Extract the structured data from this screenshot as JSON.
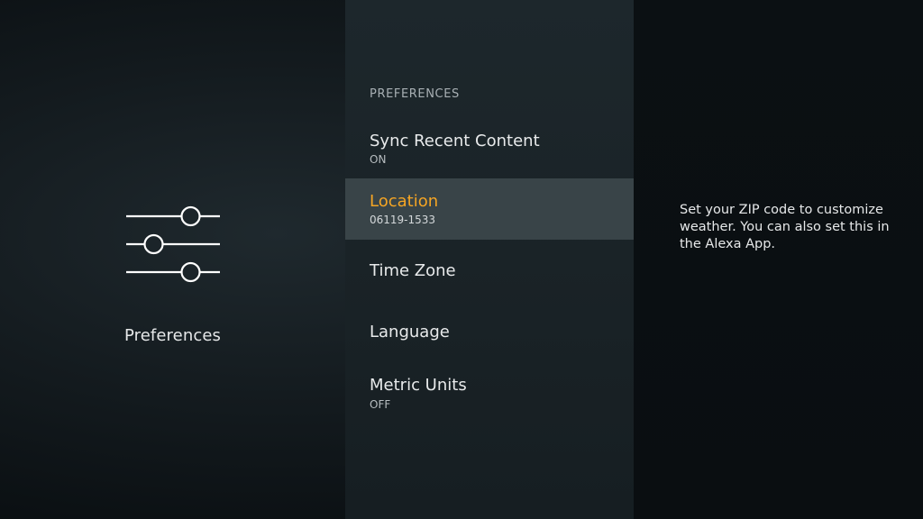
{
  "left": {
    "icon": "sliders-icon",
    "title": "Preferences"
  },
  "menu": {
    "header": "PREFERENCES",
    "items": [
      {
        "label": "Sync Recent Content",
        "value": "ON",
        "selected": false
      },
      {
        "label": "Location",
        "value": "06119-1533",
        "selected": true
      },
      {
        "label": "Time Zone",
        "value": "",
        "selected": false
      },
      {
        "label": "Language",
        "value": "",
        "selected": false
      },
      {
        "label": "Metric Units",
        "value": "OFF",
        "selected": false
      }
    ]
  },
  "description": {
    "text": "Set your ZIP code to customize weather. You can also set this in the Alexa App."
  },
  "colors": {
    "accent": "#f5a524",
    "selected_row": "#394448"
  }
}
